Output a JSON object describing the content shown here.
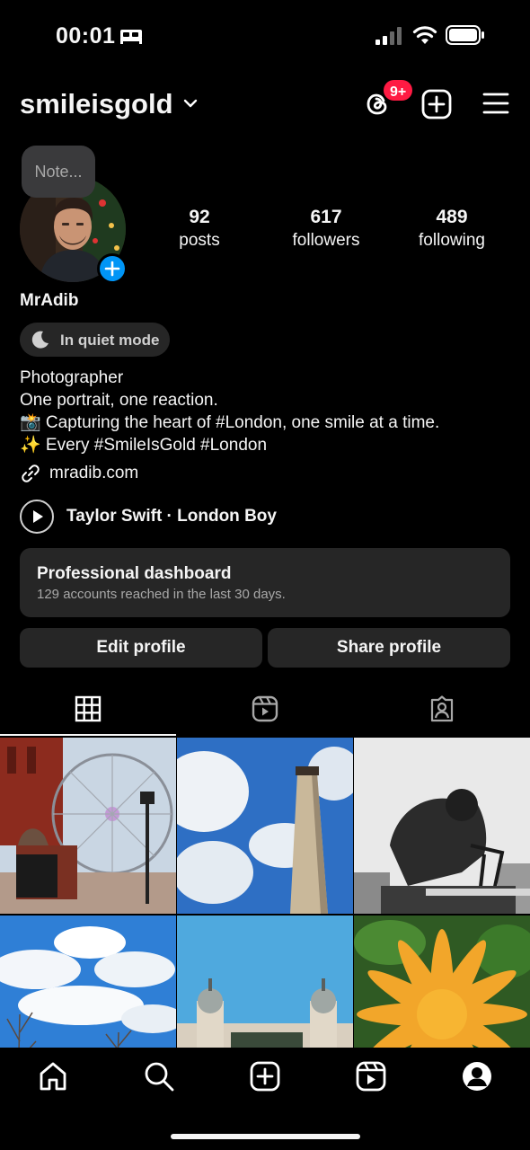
{
  "status_bar": {
    "time": "00:01"
  },
  "header": {
    "username": "smileisgold",
    "notification_badge": "9+"
  },
  "profile": {
    "note_placeholder": "Note...",
    "stats": [
      {
        "value": "92",
        "label": "posts"
      },
      {
        "value": "617",
        "label": "followers"
      },
      {
        "value": "489",
        "label": "following"
      }
    ],
    "display_name": "MrAdib",
    "quiet_mode": "In quiet mode",
    "bio": [
      "Photographer",
      "One portrait, one reaction.",
      "📸 Capturing the heart of #London, one smile at a time.",
      "✨ Every #SmileIsGold #London"
    ],
    "link": "mradib.com",
    "music": "Taylor Swift · London Boy"
  },
  "dashboard": {
    "title": "Professional dashboard",
    "subtitle": "129 accounts reached in the last 30 days."
  },
  "buttons": {
    "edit": "Edit profile",
    "share": "Share profile"
  },
  "tabs": [
    "grid-icon",
    "reels-icon",
    "tagged-icon"
  ],
  "bottom_nav": [
    "home-icon",
    "search-icon",
    "create-icon",
    "reels-icon",
    "profile-icon"
  ],
  "colors": {
    "accent_blue": "#0095f6",
    "badge_red": "#ff1a43",
    "surface": "#262626",
    "background": "#000000"
  }
}
